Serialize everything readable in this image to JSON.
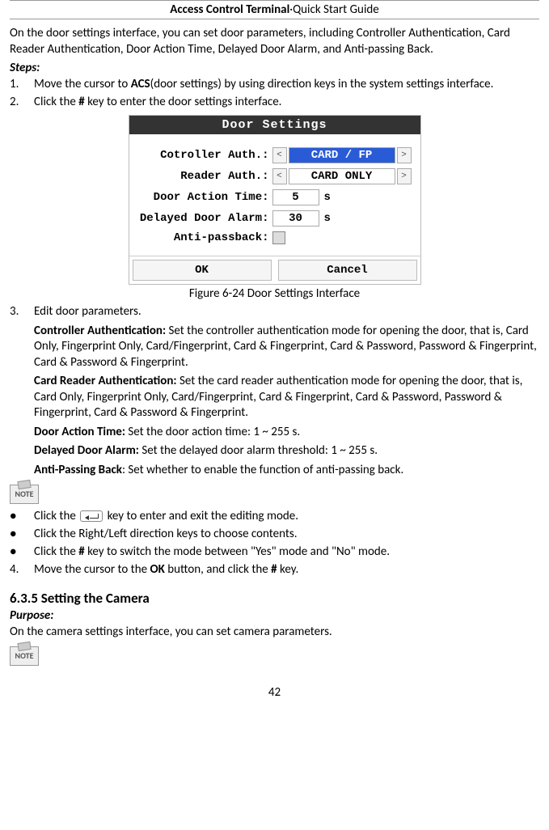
{
  "header": {
    "bold": "Access Control Terminal",
    "sep": "·",
    "rest": "Quick Start Guide"
  },
  "intro": "On the door settings interface, you can set door parameters, including Controller Authentication, Card Reader Authentication, Door Action Time, Delayed Door Alarm, and Anti-passing Back.",
  "steps_label": "Steps:",
  "step1": {
    "num": "1.",
    "pre": "Move the cursor to ",
    "b": "ACS",
    "post": "(door settings) by using direction keys in the system settings interface."
  },
  "step2": {
    "num": "2.",
    "pre": "Click the ",
    "b": "#",
    "post": " key to enter the door settings interface."
  },
  "door_ui": {
    "title": "Door Settings",
    "controller_label": "Cotroller Auth.:",
    "controller_value": "CARD / FP",
    "reader_label": "Reader Auth.:",
    "reader_value": "CARD ONLY",
    "action_label": "Door Action Time:",
    "action_value": "5",
    "action_unit": "s",
    "delayed_label": "Delayed Door Alarm:",
    "delayed_value": "30",
    "delayed_unit": "s",
    "anti_label": "Anti-passback:",
    "ok": "OK",
    "cancel": "Cancel",
    "left": "<",
    "right": ">"
  },
  "fig_caption": "Figure 6-24 Door Settings Interface",
  "step3": {
    "num": "3.",
    "text": "Edit door parameters."
  },
  "defs": {
    "ca_b": "Controller Authentication: ",
    "ca": "Set the controller authentication mode for opening the door, that is, Card Only, Fingerprint Only, Card/Fingerprint, Card & Fingerprint, Card & Password, Password & Fingerprint, Card & Password & Fingerprint.",
    "ra_b": "Card Reader Authentication: ",
    "ra": "Set the card reader authentication mode for opening the door, that is, Card Only, Fingerprint Only, Card/Fingerprint, Card & Fingerprint, Card & Password, Password & Fingerprint, Card & Password & Fingerprint.",
    "dat_b": "Door Action Time: ",
    "dat": "Set the door action time: 1 ~ 255 s.",
    "dda_b": "Delayed Door Alarm: ",
    "dda": "Set the delayed door alarm threshold: 1 ~ 255 s.",
    "apb_b": "Anti-Passing Back",
    "apb": ": Set whether to enable the function of anti-passing back."
  },
  "note_label": "NOTE",
  "bullets": {
    "b1_pre": "Click the ",
    "b1_post": " key to enter and exit the editing mode.",
    "b2": "Click the Right/Left direction keys to choose contents.",
    "b3_pre": "Click the ",
    "b3_b": "#",
    "b3_post": " key to switch the mode between \"Yes\" mode and \"No\" mode."
  },
  "step4": {
    "num": "4.",
    "pre": "Move the cursor to the ",
    "b": "OK",
    "mid": " button, and click the ",
    "b2": "#",
    "post": " key."
  },
  "section": "6.3.5 Setting the Camera",
  "purpose": "Purpose:",
  "camera_text": "On the camera settings interface, you can set camera parameters.",
  "page_num": "42"
}
